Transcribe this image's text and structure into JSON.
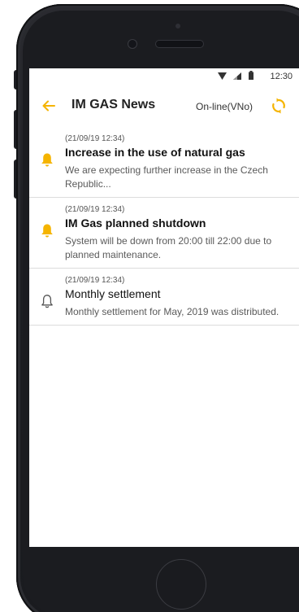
{
  "status_bar": {
    "time": "12:30",
    "icons": [
      "wifi-icon",
      "signal-icon",
      "battery-icon"
    ]
  },
  "app_bar": {
    "title": "IM GAS News",
    "connection_status": "On-line(VNo)",
    "back_icon": "arrow-left-icon",
    "refresh_icon": "refresh-icon"
  },
  "colors": {
    "accent": "#f5b400",
    "text_primary": "#111111",
    "text_secondary": "#5a5a5a",
    "divider": "#dcdcdc",
    "icon_unread": "#f5b400",
    "icon_read": "#555555"
  },
  "news": [
    {
      "date": "(21/09/19 12:34)",
      "title": "Increase in the use of natural gas",
      "body": "We are expecting further increase in the Czech Republic...",
      "unread": true
    },
    {
      "date": "(21/09/19 12:34)",
      "title": "IM Gas planned shutdown",
      "body": "System will be down from 20:00 till 22:00 due to planned maintenance.",
      "unread": true
    },
    {
      "date": "(21/09/19 12:34)",
      "title": "Monthly settlement",
      "body": "Monthly settlement for May, 2019 was distributed.",
      "unread": false
    }
  ]
}
